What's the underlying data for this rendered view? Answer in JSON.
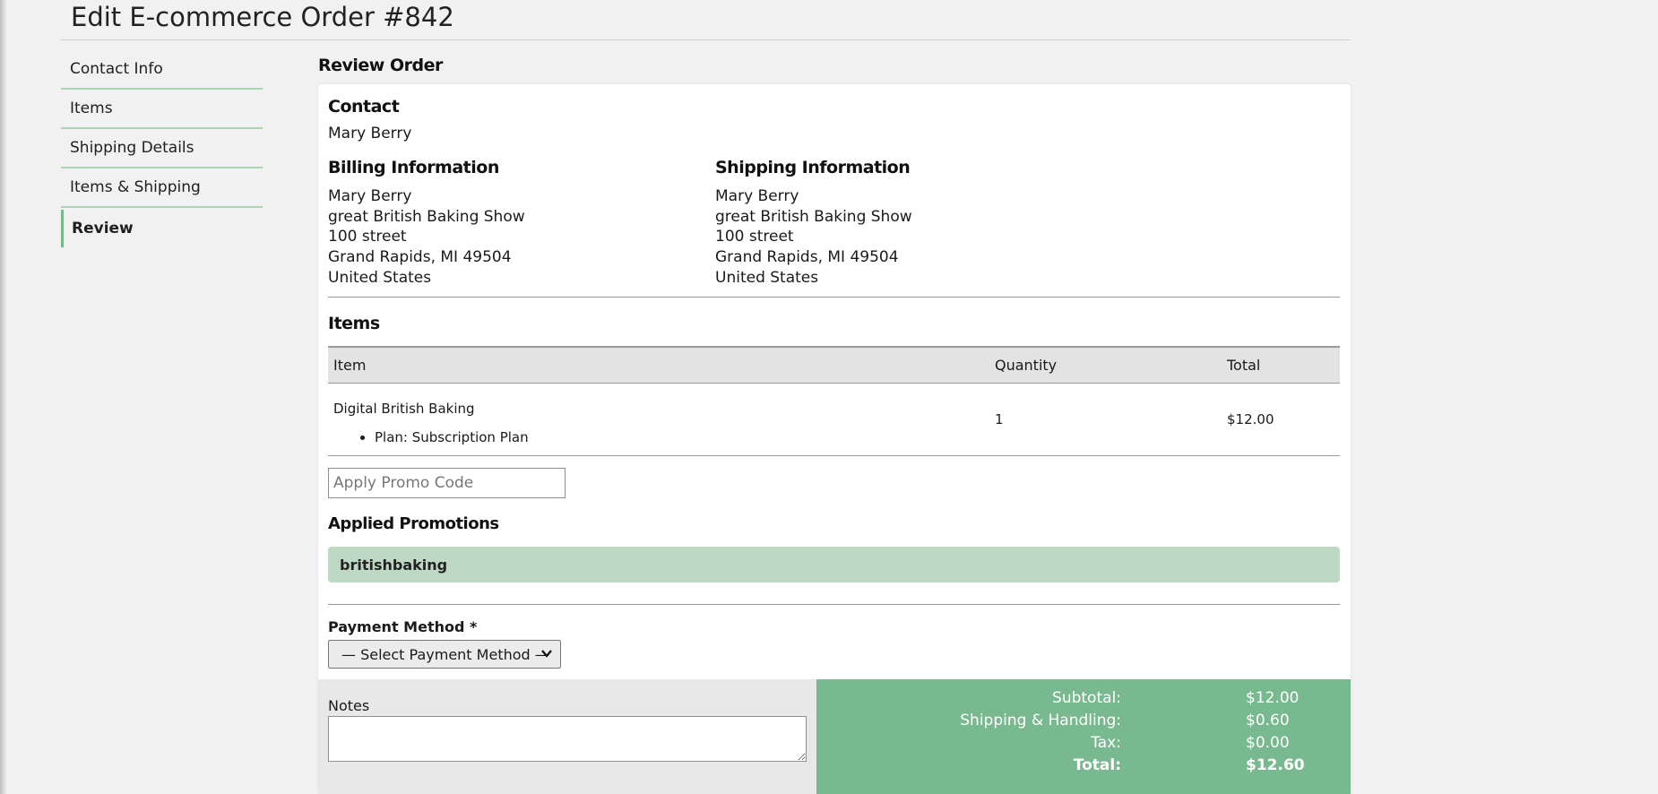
{
  "page": {
    "title": "Edit E-commerce Order #842"
  },
  "sidebar": {
    "items": [
      {
        "label": "Contact Info"
      },
      {
        "label": "Items"
      },
      {
        "label": "Shipping Details"
      },
      {
        "label": "Items & Shipping"
      },
      {
        "label": "Review",
        "active": true
      }
    ]
  },
  "main": {
    "section_title": "Review Order",
    "contact": {
      "heading": "Contact",
      "name": "Mary Berry"
    },
    "billing": {
      "heading": "Billing Information",
      "lines": [
        "Mary Berry",
        "great British Baking Show",
        "100 street",
        "Grand Rapids, MI 49504",
        "United States"
      ]
    },
    "shipping": {
      "heading": "Shipping Information",
      "lines": [
        "Mary Berry",
        "great British Baking Show",
        "100 street",
        "Grand Rapids, MI 49504",
        "United States"
      ]
    },
    "items": {
      "heading": "Items",
      "columns": [
        "Item",
        "Quantity",
        "Total"
      ],
      "rows": [
        {
          "name": "Digital British Baking",
          "details": [
            "Plan: Subscription Plan"
          ],
          "quantity": "1",
          "total": "$12.00"
        }
      ]
    },
    "promo": {
      "placeholder": "Apply Promo Code",
      "applied_heading": "Applied Promotions",
      "applied": [
        "britishbaking"
      ]
    },
    "payment": {
      "label": "Payment Method *",
      "selected": "— Select Payment Method —"
    },
    "notes": {
      "label": "Notes",
      "value": ""
    },
    "totals": {
      "subtotal_label": "Subtotal:",
      "subtotal": "$12.00",
      "shipping_label": "Shipping & Handling:",
      "shipping": "$0.60",
      "tax_label": "Tax:",
      "tax": "$0.00",
      "total_label": "Total:",
      "total": "$12.60"
    }
  },
  "colors": {
    "accent_green": "#79b98f",
    "promo_green": "#bed9c3",
    "sidebar_rule": "#a9d5b3"
  }
}
